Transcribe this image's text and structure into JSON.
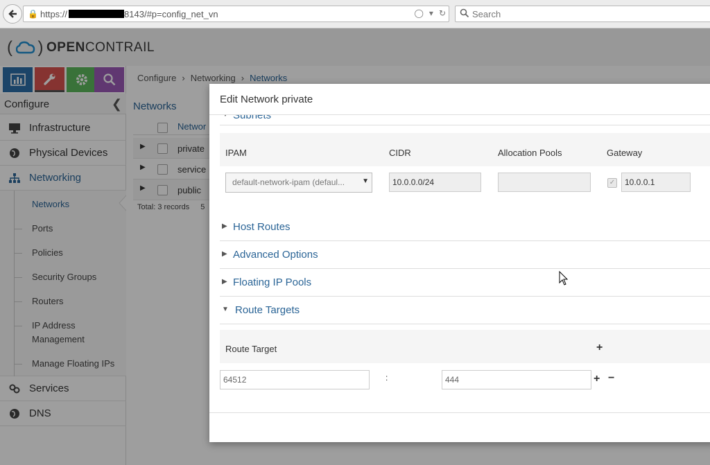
{
  "browser": {
    "url_prefix": "https://",
    "url_suffix": "8143/#p=config_net_vn",
    "search_placeholder": "Search"
  },
  "app": {
    "logo_light": "OPEN",
    "logo_bold": "CONTRAIL"
  },
  "sidebar": {
    "header": "Configure",
    "sections": {
      "infrastructure": "Infrastructure",
      "physical_devices": "Physical Devices",
      "networking": "Networking",
      "services": "Services",
      "dns": "DNS"
    },
    "networking_items": [
      {
        "label": "Networks"
      },
      {
        "label": "Ports"
      },
      {
        "label": "Policies"
      },
      {
        "label": "Security Groups"
      },
      {
        "label": "Routers"
      },
      {
        "label": "IP Address"
      },
      {
        "label": "Management"
      },
      {
        "label": "Manage Floating IPs"
      }
    ]
  },
  "breadcrumb": [
    "Configure",
    "Networking",
    "Networks"
  ],
  "networks_panel": {
    "title": "Networks",
    "column_header": "Networ",
    "rows": [
      "private",
      "service",
      "public"
    ],
    "total": "Total: 3 records",
    "page_size_fragment": "5"
  },
  "modal": {
    "title": "Edit Network private",
    "subnets_label": "Subnets",
    "subnet_headers": {
      "ipam": "IPAM",
      "cidr": "CIDR",
      "allocation_pools": "Allocation Pools",
      "gateway": "Gateway"
    },
    "subnet_row": {
      "ipam": "default-network-ipam (defaul...",
      "cidr": "10.0.0.0/24",
      "allocation_pools": "",
      "gateway": "10.0.0.1"
    },
    "sections": {
      "host_routes": "Host Routes",
      "advanced_options": "Advanced Options",
      "floating_ip_pools": "Floating IP Pools",
      "route_targets": "Route Targets"
    },
    "route_target_header": "Route Target",
    "route_target_row": {
      "asn": "64512",
      "separator": ":",
      "target": "444"
    }
  }
}
